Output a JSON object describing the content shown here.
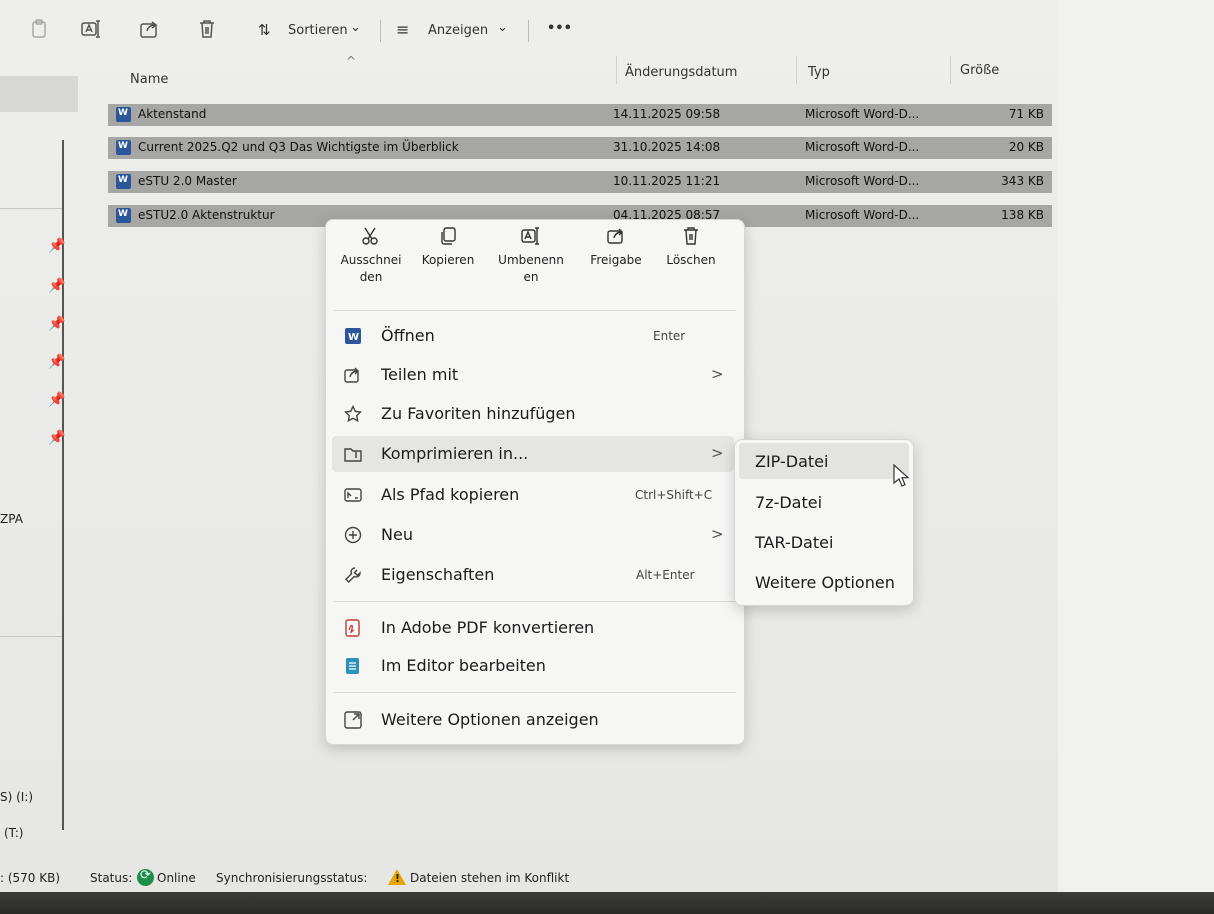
{
  "toolbar": {
    "sort_label": "Sortieren",
    "view_label": "Anzeigen",
    "more_label": "•••",
    "dropdown_glyph": "⌄",
    "sort_glyph": "⇅",
    "view_glyph": "≡"
  },
  "sidebar": {
    "partial_label_1": "ZPA",
    "drive_1": "S) (I:)",
    "drive_2": "(T:)",
    "selected_size": ": (570 KB)",
    "pin_glyph": "📌"
  },
  "table": {
    "headers": [
      "Name",
      "Änderungsdatum",
      "Typ",
      "Größe"
    ],
    "sort_caret": "^",
    "rows": [
      {
        "name": "Aktenstand",
        "date": "14.11.2025 09:58",
        "type": "Microsoft Word-D...",
        "size": "71 KB"
      },
      {
        "name": "Current 2025.Q2 und Q3 Das Wichtigste im Überblick",
        "date": "31.10.2025 14:08",
        "type": "Microsoft Word-D...",
        "size": "20 KB"
      },
      {
        "name": "eSTU 2.0 Master",
        "date": "10.11.2025 11:21",
        "type": "Microsoft Word-D...",
        "size": "343 KB"
      },
      {
        "name": "eSTU2.0 Aktenstruktur",
        "date": "04.11.2025 08:57",
        "type": "Microsoft Word-D...",
        "size": "138 KB"
      }
    ]
  },
  "context_menu": {
    "quick_actions": [
      {
        "label_l1": "Ausschnei",
        "label_l2": "den",
        "icon": "cut-icon"
      },
      {
        "label_l1": "Kopieren",
        "label_l2": "",
        "icon": "copy-icon"
      },
      {
        "label_l1": "Umbenenn",
        "label_l2": "en",
        "icon": "rename-icon"
      },
      {
        "label_l1": "Freigabe",
        "label_l2": "",
        "icon": "share-icon"
      },
      {
        "label_l1": "Löschen",
        "label_l2": "",
        "icon": "trash-icon"
      }
    ],
    "items": [
      {
        "label": "Öffnen",
        "shortcut": "Enter",
        "icon": "word-icon"
      },
      {
        "label": "Teilen mit",
        "arrow": ">",
        "icon": "share-icon"
      },
      {
        "label": "Zu Favoriten hinzufügen",
        "icon": "star-icon"
      },
      {
        "label": "Komprimieren in...",
        "arrow": ">",
        "icon": "zip-folder-icon"
      },
      {
        "label": "Als Pfad kopieren",
        "shortcut": "Ctrl+Shift+C",
        "icon": "path-icon"
      },
      {
        "label": "Neu",
        "arrow": ">",
        "icon": "plus-circle-icon"
      },
      {
        "label": "Eigenschaften",
        "shortcut": "Alt+Enter",
        "icon": "wrench-icon"
      },
      {
        "label": "In Adobe PDF konvertieren",
        "icon": "pdf-icon"
      },
      {
        "label": "Im Editor bearbeiten",
        "icon": "notepad-icon"
      },
      {
        "label": "Weitere Optionen anzeigen",
        "icon": "more-options-icon"
      }
    ]
  },
  "submenu": {
    "items": [
      "ZIP-Datei",
      "7z-Datei",
      "TAR-Datei",
      "Weitere Optionen"
    ]
  },
  "status_bar": {
    "status_label": "Status:",
    "status_value": "Online",
    "sync_label": "Synchronisierungsstatus:",
    "sync_value": "Dateien stehen im Konflikt"
  },
  "colors": {
    "selected_row": "#a6a6a4",
    "word_blue": "#2b579a",
    "online_green": "#1a8f4a",
    "warning_yellow": "#e6a400"
  }
}
